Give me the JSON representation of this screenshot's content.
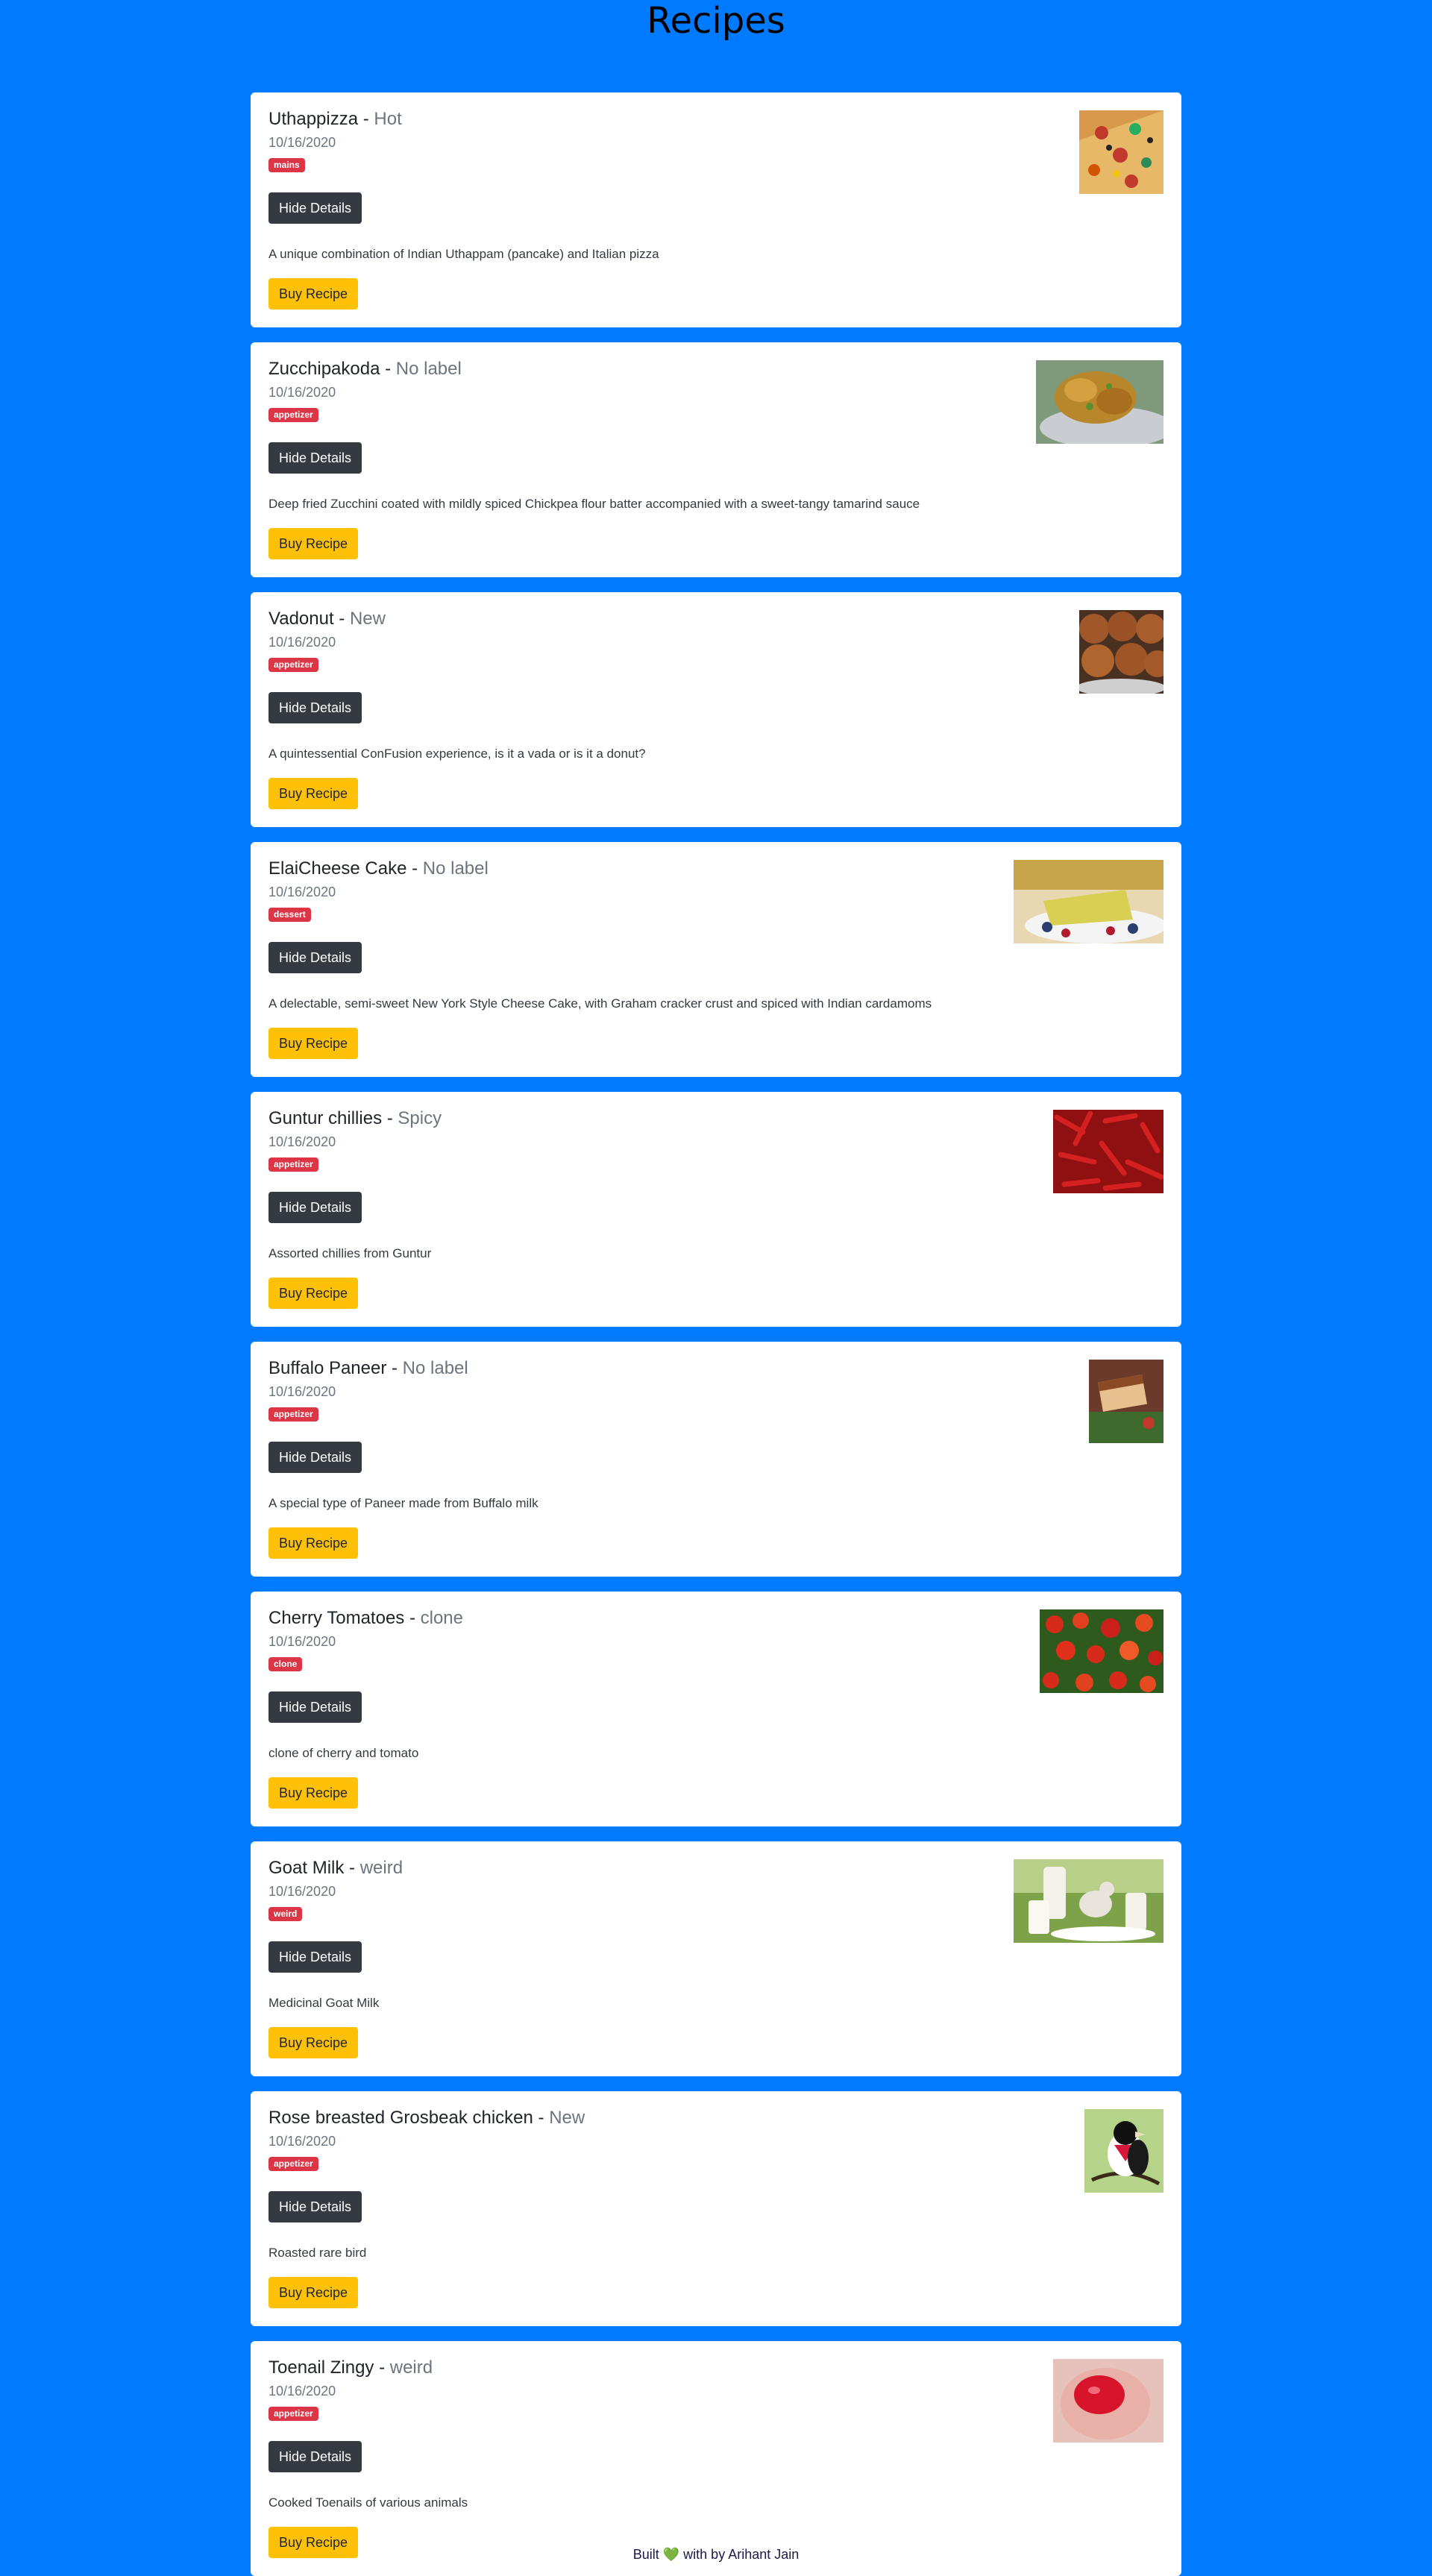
{
  "page": {
    "title": "Recipes"
  },
  "common": {
    "separator": " - ",
    "hide_details_label": "Hide Details",
    "buy_label": "Buy Recipe"
  },
  "recipes": [
    {
      "name": "Uthappizza",
      "label": "Hot",
      "date": "10/16/2020",
      "category": "mains",
      "description": "A unique combination of Indian Uthappam (pancake) and Italian pizza",
      "image": "pizza-image"
    },
    {
      "name": "Zucchipakoda",
      "label": "No label",
      "date": "10/16/2020",
      "category": "appetizer",
      "description": "Deep fried Zucchini coated with mildly spiced Chickpea flour batter accompanied with a sweet-tangy tamarind sauce",
      "image": "pakoda-image"
    },
    {
      "name": "Vadonut",
      "label": "New",
      "date": "10/16/2020",
      "category": "appetizer",
      "description": "A quintessential ConFusion experience, is it a vada or is it a donut?",
      "image": "vadonut-image"
    },
    {
      "name": "ElaiCheese Cake",
      "label": "No label",
      "date": "10/16/2020",
      "category": "dessert",
      "description": "A delectable, semi-sweet New York Style Cheese Cake, with Graham cracker crust and spiced with Indian cardamoms",
      "image": "cheesecake-image"
    },
    {
      "name": "Guntur chillies",
      "label": "Spicy",
      "date": "10/16/2020",
      "category": "appetizer",
      "description": "Assorted chillies from Guntur",
      "image": "chillies-image"
    },
    {
      "name": "Buffalo Paneer",
      "label": "No label",
      "date": "10/16/2020",
      "category": "appetizer",
      "description": "A special type of Paneer made from Buffalo milk",
      "image": "paneer-image"
    },
    {
      "name": "Cherry Tomatoes",
      "label": "clone",
      "date": "10/16/2020",
      "category": "clone",
      "description": "clone of cherry and tomato",
      "image": "tomatoes-image"
    },
    {
      "name": "Goat Milk",
      "label": "weird",
      "date": "10/16/2020",
      "category": "weird",
      "description": "Medicinal Goat Milk",
      "image": "goat-milk-image"
    },
    {
      "name": "Rose breasted Grosbeak chicken",
      "label": "New",
      "date": "10/16/2020",
      "category": "appetizer",
      "description": "Roasted rare bird",
      "image": "grosbeak-image"
    },
    {
      "name": "Toenail Zingy",
      "label": "weird",
      "date": "10/16/2020",
      "category": "appetizer",
      "description": "Cooked Toenails of various animals",
      "image": "toenail-image"
    }
  ],
  "footer": {
    "prefix": "Built ",
    "heart": "💚",
    "suffix": " with by Arihant Jain"
  },
  "colors": {
    "background": "#007bff",
    "badge": "#dc3545",
    "hide_button": "#343a40",
    "buy_button": "#ffc107",
    "muted": "#6c757d"
  }
}
